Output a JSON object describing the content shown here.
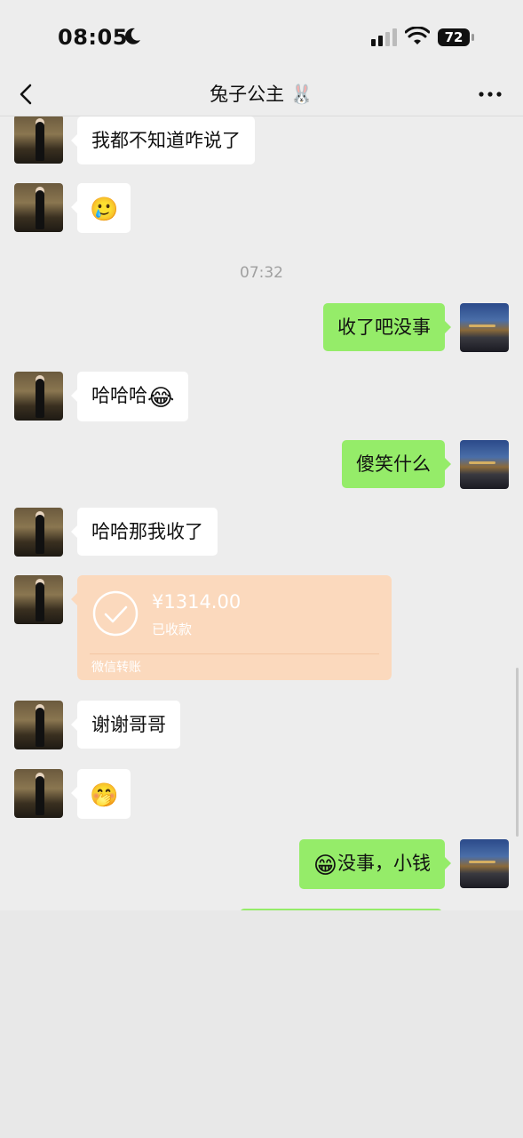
{
  "status_bar": {
    "time": "08:05",
    "battery": "72"
  },
  "header": {
    "title": "兔子公主",
    "title_emoji": "🐰"
  },
  "messages": [
    {
      "side": "left",
      "text": "我都不知道咋说了"
    },
    {
      "side": "left",
      "emoji": "🥲"
    },
    {
      "timestamp": "07:32"
    },
    {
      "side": "right",
      "text": "收了吧没事"
    },
    {
      "side": "left",
      "text": "哈哈哈",
      "emoji": "😂"
    },
    {
      "side": "right",
      "text": "傻笑什么"
    },
    {
      "side": "left",
      "text": "哈哈那我收了"
    },
    {
      "side": "left",
      "type": "transfer",
      "amount": "¥1314.00",
      "status": "已收款",
      "label": "微信转账"
    },
    {
      "side": "left",
      "text": "谢谢哥哥"
    },
    {
      "side": "left",
      "emoji": "🤭"
    },
    {
      "side": "right",
      "emoji": "😁",
      "text": "没事，小钱"
    }
  ]
}
